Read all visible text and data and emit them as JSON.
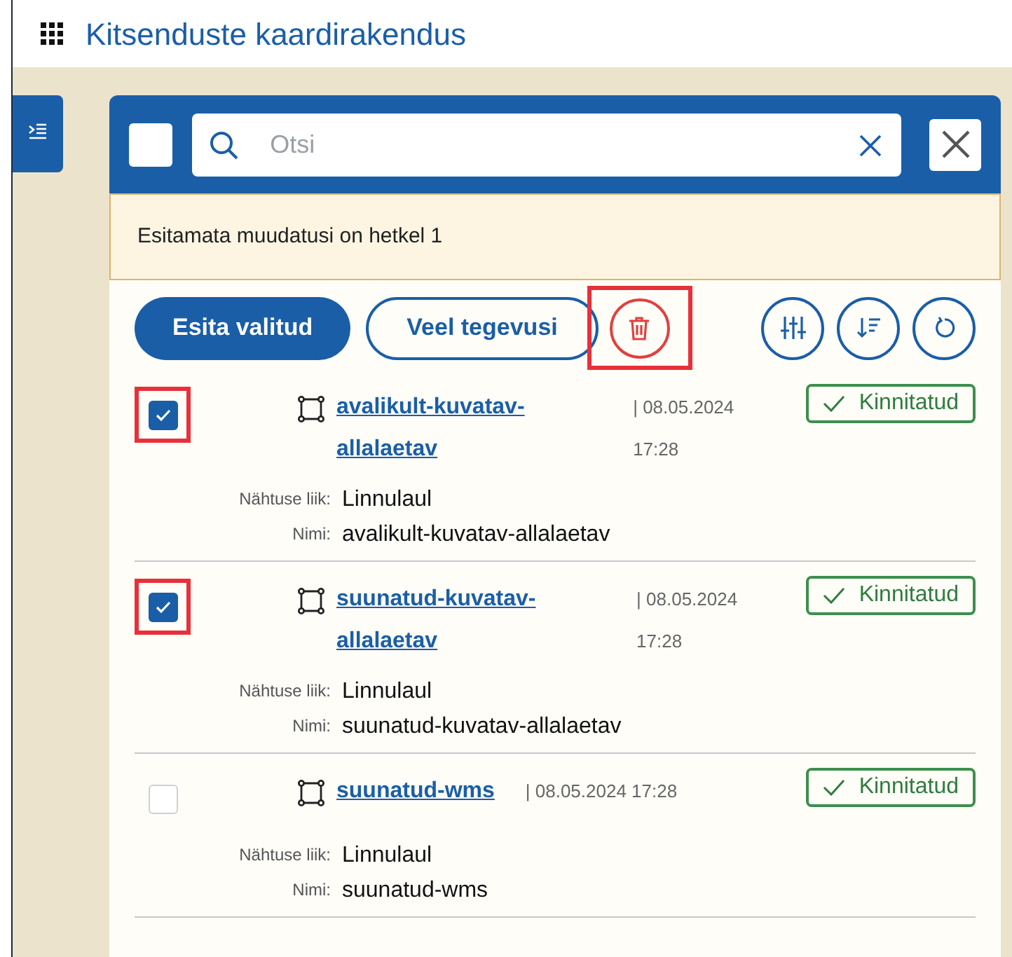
{
  "app_title": "Kitsenduste kaardirakendus",
  "search": {
    "placeholder": "Otsi"
  },
  "select_all": {
    "checked": false
  },
  "notice": "Esitamata muudatusi on hetkel 1",
  "toolbar": {
    "primary": "Esita valitud",
    "secondary": "Veel tegevusi",
    "delete_highlighted": true
  },
  "items": [
    {
      "title": "avalikult-kuvatav-allalaetav",
      "date": "| 08.05.2024 17:28",
      "status": "Kinnitatud",
      "checked": true,
      "highlighted": true,
      "fields": [
        {
          "label": "Nähtuse liik:",
          "value": "Linnulaul"
        },
        {
          "label": "Nimi:",
          "value": "avalikult-kuvatav-allalaetav"
        }
      ]
    },
    {
      "title": "suunatud-kuvatav-allalaetav",
      "date": "| 08.05.2024 17:28",
      "status": "Kinnitatud",
      "checked": true,
      "highlighted": true,
      "fields": [
        {
          "label": "Nähtuse liik:",
          "value": "Linnulaul"
        },
        {
          "label": "Nimi:",
          "value": "suunatud-kuvatav-allalaetav"
        }
      ]
    },
    {
      "title": "suunatud-wms",
      "date": "| 08.05.2024 17:28",
      "status": "Kinnitatud",
      "checked": false,
      "highlighted": false,
      "fields": [
        {
          "label": "Nähtuse liik:",
          "value": "Linnulaul"
        },
        {
          "label": "Nimi:",
          "value": "suunatud-wms"
        }
      ]
    }
  ]
}
